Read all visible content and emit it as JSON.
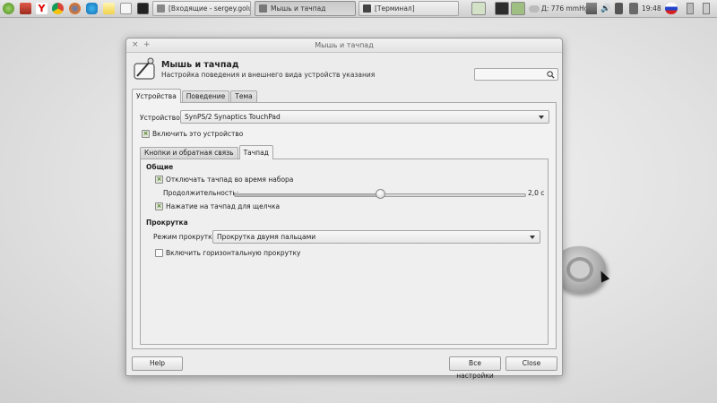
{
  "taskbar": {
    "tasks": [
      {
        "label": "[Входящие - sergey.golube..."
      },
      {
        "label": "Мышь и тачпад"
      },
      {
        "label": "[Терминал]"
      }
    ],
    "weather": "Д: 776 mmHg",
    "clock": "19:48"
  },
  "window": {
    "title": "Мышь и тачпад",
    "close_glyph": "×",
    "pin_glyph": "+",
    "header": {
      "title": "Мышь и тачпад",
      "subtitle": "Настройка поведения и внешнего вида устройств указания"
    },
    "search": {
      "placeholder": ""
    },
    "tabs": [
      {
        "label": "Устройства"
      },
      {
        "label": "Поведение"
      },
      {
        "label": "Тема"
      }
    ],
    "device_label": "Устройство:",
    "device_value": "SynPS/2 Synaptics TouchPad",
    "enable_device_label": "Включить это устройство",
    "enable_device_checked": true,
    "subtabs": [
      {
        "label": "Кнопки и обратная связь"
      },
      {
        "label": "Тачпад"
      }
    ],
    "general": {
      "heading": "Общие",
      "disable_while_typing": "Отключать тачпад во время набора",
      "disable_while_typing_checked": true,
      "duration_label": "Продолжительность:",
      "duration_value": "2,0 с",
      "duration_fraction": 0.5,
      "tap_to_click": "Нажатие на тачпад для щелчка",
      "tap_to_click_checked": true
    },
    "scrolling": {
      "heading": "Прокрутка",
      "mode_label": "Режим прокрутки:",
      "mode_value": "Прокрутка двумя пальцами",
      "horizontal_label": "Включить горизонтальную прокрутку",
      "horizontal_checked": false
    },
    "buttons": {
      "help": "Help",
      "all_settings": "Все настройки",
      "close": "Close"
    }
  }
}
